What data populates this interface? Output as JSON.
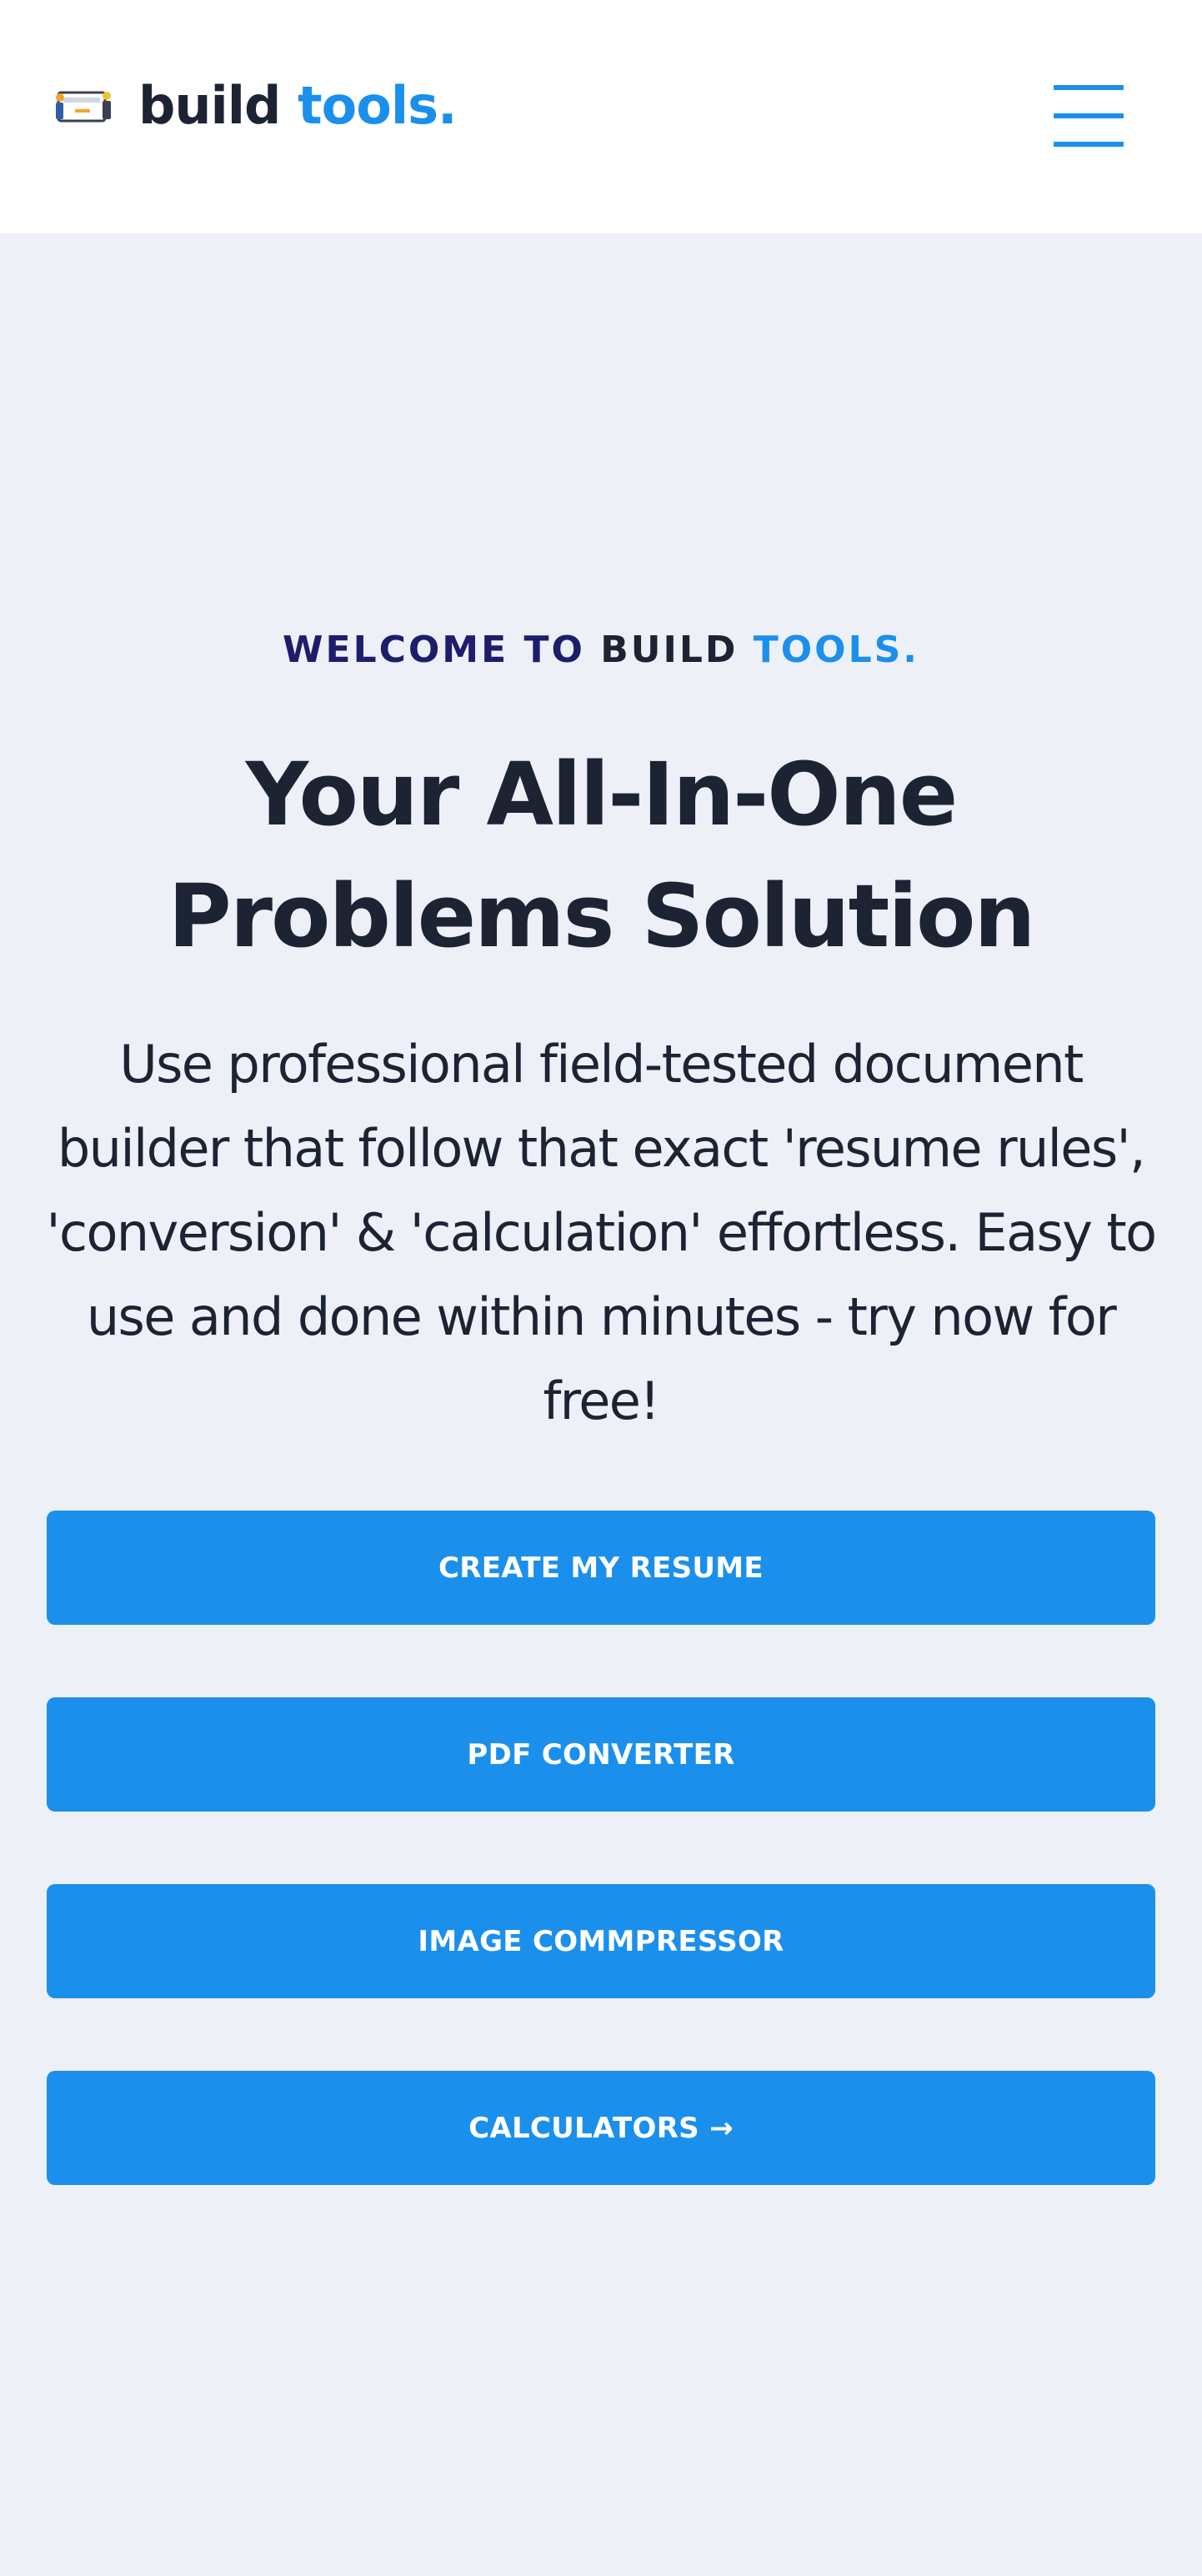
{
  "header": {
    "logo": {
      "word1": "build",
      "word2": "tools."
    },
    "menu_icon": "hamburger-menu-icon"
  },
  "hero": {
    "eyebrow": {
      "part1": "WELCOME TO",
      "part2": "BUILD",
      "part3": "TOOLS."
    },
    "title": "Your All-In-One Problems Solution",
    "description": "Use professional field-tested document builder that follow that exact 'resume rules', 'conversion' & 'calculation' effortless. Easy to use and done within minutes - try now for free!"
  },
  "buttons": {
    "create_resume": "CREATE MY RESUME",
    "pdf_converter": "PDF CONVERTER",
    "image_compressor": "IMAGE COMMPRESSOR",
    "calculators": "CALCULATORS →"
  },
  "colors": {
    "accent": "#1b8fec",
    "background": "#eef0f8",
    "text": "#1c2333",
    "eyebrow_navy": "#1e1d6b"
  }
}
